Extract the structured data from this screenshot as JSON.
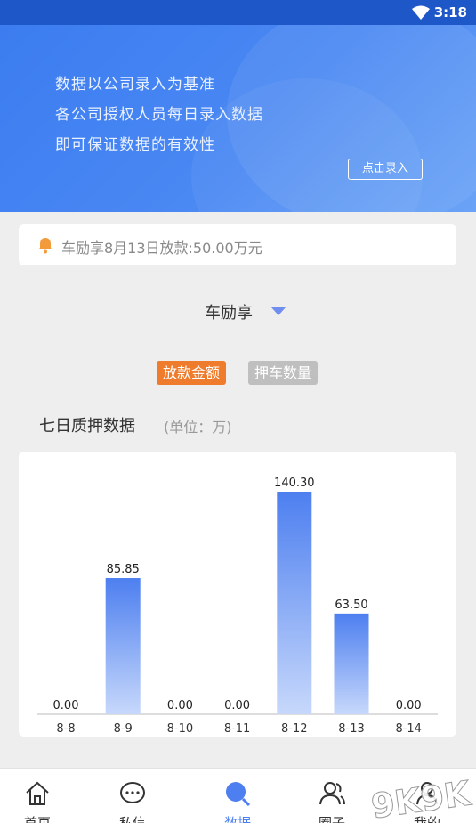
{
  "status_bar": {
    "time": "3:18"
  },
  "banner": {
    "lines": [
      "数据以公司录入为基准",
      "各公司授权人员每日录入数据",
      "即可保证数据的有效性"
    ],
    "button_label": "点击录入"
  },
  "notice": {
    "text": "车励享8月13日放款:50.00万元"
  },
  "selector": {
    "value": "车励享"
  },
  "tabs": {
    "active": "放款金额",
    "inactive": "押车数量"
  },
  "chart_header": {
    "title": "七日质押数据",
    "unit": "(单位：万)"
  },
  "chart_data": {
    "type": "bar",
    "categories": [
      "8-8",
      "8-9",
      "8-10",
      "8-11",
      "8-12",
      "8-13",
      "8-14"
    ],
    "values": [
      0.0,
      85.85,
      0.0,
      0.0,
      140.3,
      63.5,
      0.0
    ],
    "value_labels": [
      "0.00",
      "85.85",
      "0.00",
      "0.00",
      "140.30",
      "63.50",
      "0.00"
    ],
    "colors": {
      "bar_top": "#4d7ff0",
      "bar_bottom": "#c7d8fb"
    }
  },
  "bottom_nav": [
    {
      "label": "首页",
      "icon": "home-icon"
    },
    {
      "label": "私信",
      "icon": "chat-icon"
    },
    {
      "label": "数据",
      "icon": "search-icon"
    },
    {
      "label": "圈子",
      "icon": "users-icon"
    },
    {
      "label": "我的",
      "icon": "user-icon"
    }
  ],
  "watermark": "9K9K"
}
